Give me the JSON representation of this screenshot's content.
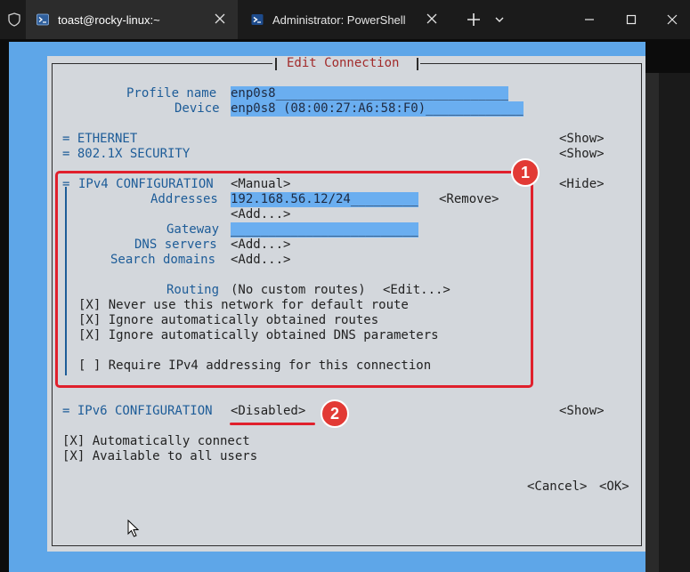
{
  "tabs": [
    {
      "title": "toast@rocky-linux:~",
      "icon": "terminal-icon"
    },
    {
      "title": "Administrator: PowerShell",
      "icon": "powershell-icon"
    }
  ],
  "dialog": {
    "title": "Edit Connection",
    "profile_label": "Profile name",
    "profile_value": "enp0s8",
    "profile_fill": "_______________________________",
    "device_label": "Device",
    "device_value": "enp0s8 (08:00:27:A6:58:F0)",
    "device_fill": "_____________",
    "ethernet": "= ETHERNET",
    "security": "= 802.1X SECURITY",
    "show": "<Show>",
    "hide": "<Hide>",
    "ipv4_header": "IPv4 CONFIGURATION",
    "ipv4_marker": "=",
    "ipv4_mode": "<Manual>",
    "addresses_label": "Addresses",
    "address_value": "192.168.56.12/24",
    "address_fill": "_________",
    "remove": "<Remove>",
    "add": "<Add...>",
    "gateway_label": "Gateway",
    "gateway_fill": "_________________________",
    "dns_label": "DNS servers",
    "search_label": "Search domains",
    "routing_label": "Routing",
    "routing_value": "(No custom routes)",
    "edit": "<Edit...>",
    "opt_never_default": "[X] Never use this network for default route",
    "opt_ignore_routes": "[X] Ignore automatically obtained routes",
    "opt_ignore_dns": "[X] Ignore automatically obtained DNS parameters",
    "opt_require_ipv4": "[ ] Require IPv4 addressing for this connection",
    "ipv6_header": "= IPv6 CONFIGURATION",
    "ipv6_mode": "<Disabled>",
    "auto_connect": "[X] Automatically connect",
    "all_users": "[X] Available to all users",
    "cancel": "<Cancel>",
    "ok": "<OK>"
  },
  "annotations": {
    "badge_1": "1",
    "badge_2": "2"
  },
  "colors": {
    "accent_red": "#e0202c",
    "terminal_blue": "#5ea6e8",
    "dialog_bg": "#d3d7dc",
    "highlight": "#6aaef0"
  }
}
